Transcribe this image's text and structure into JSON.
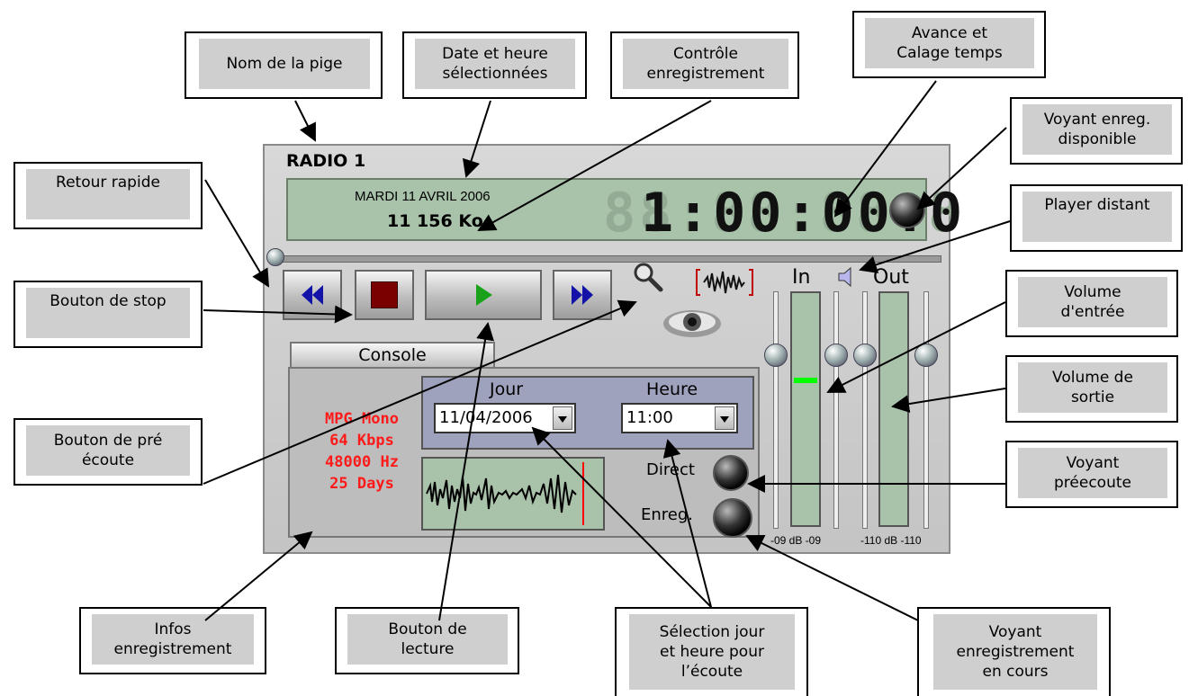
{
  "callouts": {
    "nom_pige": "Nom de la pige",
    "date_heure": "Date et heure\nsélectionnées",
    "controle_enreg": "Contrôle\nenregistrement",
    "avance_calage": "Avance et\nCalage temps",
    "voyant_dispo": "Voyant enreg.\ndisponible",
    "retour_rapide": "Retour rapide",
    "player_distant": "Player distant",
    "bouton_stop": "Bouton de stop",
    "volume_entree": "Volume\nd'entrée",
    "volume_sortie": "Volume de\nsortie",
    "bouton_preecoute": "Bouton de pré\nécoute",
    "voyant_preecoute": "Voyant\npréecoute",
    "infos_enreg": "Infos\nenregistrement",
    "bouton_lecture": "Bouton de\nlecture",
    "selection_jour_heure": "Sélection jour\net heure pour\nl’écoute",
    "voyant_en_cours": "Voyant\nenregistrement\nen cours"
  },
  "player": {
    "station": "RADIO 1",
    "date": "MARDI 11 AVRIL 2006",
    "size": "11 156 Ko",
    "time": "1:00:00.0",
    "time_ghost": "88:88:88.8",
    "console_tab": "Console",
    "info": [
      "MPG Mono",
      "64 Kbps",
      "48000 Hz",
      "25 Days"
    ],
    "jour_label": "Jour",
    "heure_label": "Heure",
    "jour_value": "11/04/2006",
    "heure_value": "11:00",
    "direct_label": "Direct",
    "enreg_label": "Enreg.",
    "in_label": "In",
    "out_label": "Out",
    "in_scale": "-09 dB -09",
    "out_scale": "-110 dB -110"
  },
  "colors": {
    "lcd": "#a9c2aa",
    "info_text": "#ff1a1a",
    "play_icon": "#1aa11a",
    "nav_icon": "#1313a8",
    "stop_icon": "#7a0000",
    "level_indicator": "#00ff00",
    "callout_fill": "#cfcfcf"
  },
  "icons": [
    "rewind-icon",
    "stop-icon",
    "play-icon",
    "fast-forward-icon",
    "magnifier-icon",
    "eye-icon",
    "waveform-record-icon",
    "speaker-icon"
  ]
}
